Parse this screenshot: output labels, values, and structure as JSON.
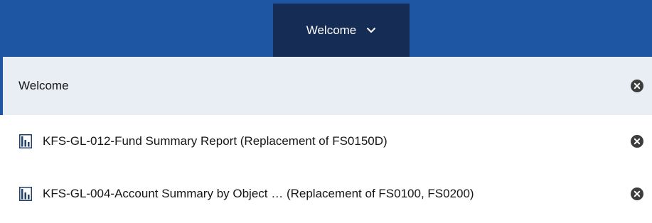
{
  "nav": {
    "active_tab": {
      "label": "Welcome",
      "icon": "chevron-down-icon"
    }
  },
  "menu": {
    "items": [
      {
        "label": "Welcome",
        "selected": true,
        "close_icon": "close-icon"
      },
      {
        "label": "KFS-GL-012-Fund Summary Report (Replacement of FS0150D)",
        "icon": "report-icon",
        "close_icon": "close-icon"
      },
      {
        "label": "KFS-GL-004-Account Summary by Object … (Replacement of FS0100, FS0200)",
        "icon": "report-icon",
        "close_icon": "close-icon"
      }
    ]
  },
  "colors": {
    "topbar": "#1f56a3",
    "active_tab": "#152c54",
    "selected_item_bg": "#e9eef5",
    "close_icon": "#3d3d3d"
  }
}
